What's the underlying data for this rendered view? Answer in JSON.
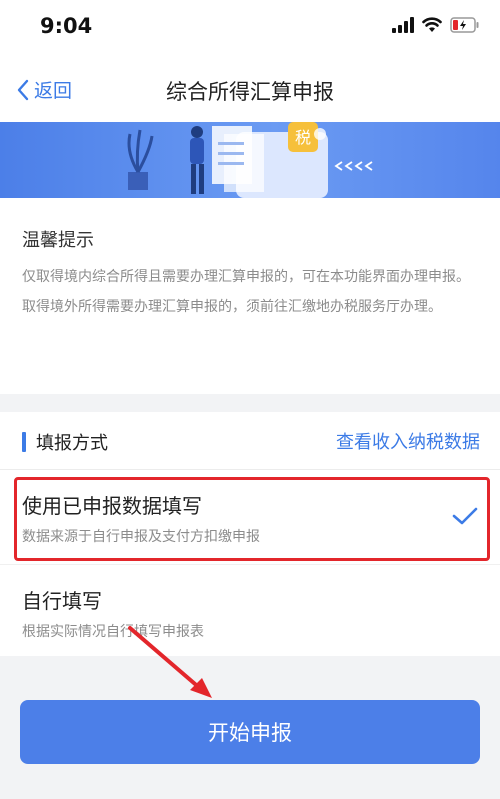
{
  "status_bar": {
    "time": "9:04"
  },
  "nav": {
    "back_label": "返回",
    "title": "综合所得汇算申报"
  },
  "banner": {
    "tax_badge": "税"
  },
  "tips": {
    "title": "温馨提示",
    "body": "仅取得境内综合所得且需要办理汇算申报的，可在本功能界面办理申报。取得境外所得需要办理汇算申报的，须前往汇缴地办税服务厅办理。"
  },
  "method": {
    "title": "填报方式",
    "view_link": "查看收入纳税数据",
    "options": [
      {
        "title": "使用已申报数据填写",
        "subtitle": "数据来源于自行申报及支付方扣缴申报",
        "selected": true
      },
      {
        "title": "自行填写",
        "subtitle": "根据实际情况自行填写申报表",
        "selected": false
      }
    ]
  },
  "actions": {
    "start_label": "开始申报"
  },
  "colors": {
    "accent": "#3c7be6",
    "button": "#4c7fe8",
    "annotation": "#e3262b"
  }
}
